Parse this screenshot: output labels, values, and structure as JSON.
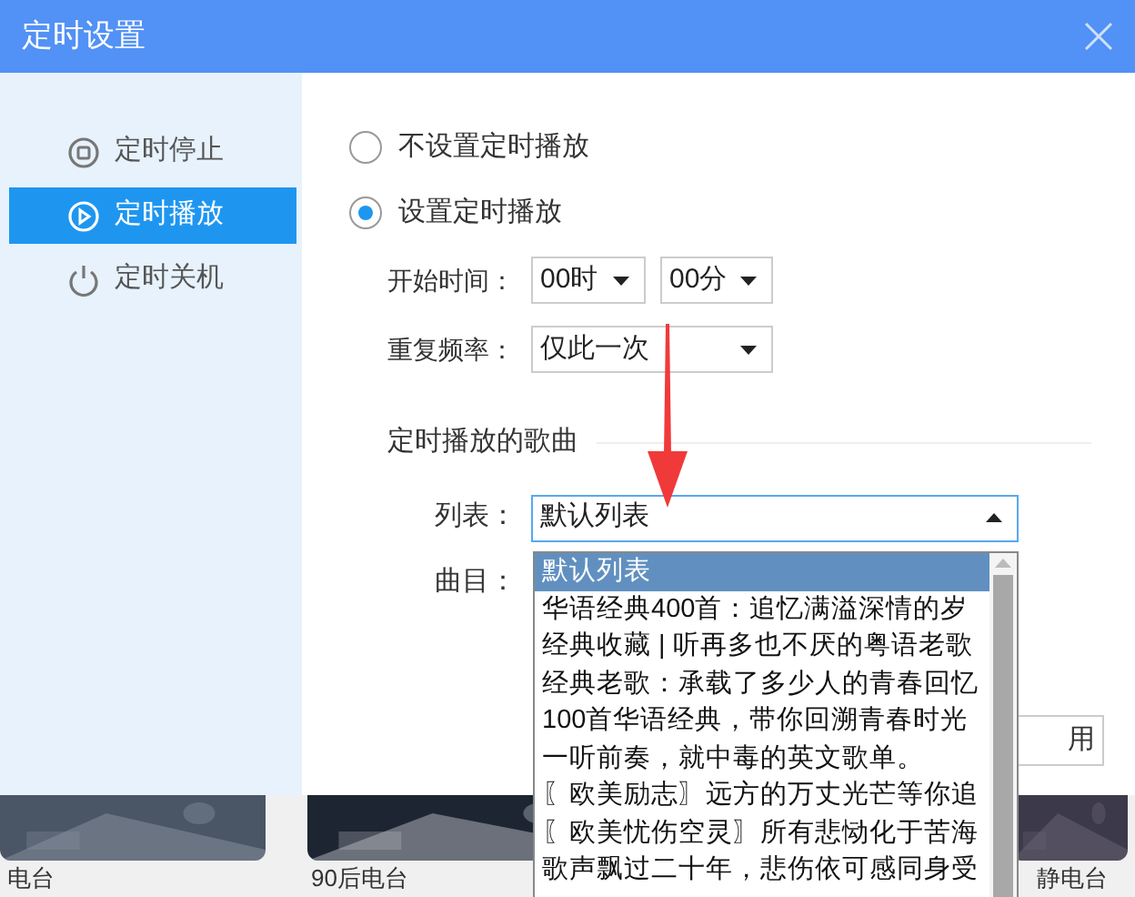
{
  "window": {
    "title": "定时设置"
  },
  "sidebar": {
    "items": [
      {
        "label": "定时停止",
        "kind": "stop",
        "selected": false
      },
      {
        "label": "定时播放",
        "kind": "play",
        "selected": true
      },
      {
        "label": "定时关机",
        "kind": "power",
        "selected": false
      }
    ]
  },
  "radios": [
    {
      "label": "不设置定时播放",
      "selected": false
    },
    {
      "label": "设置定时播放",
      "selected": true
    }
  ],
  "start_time": {
    "label": "开始时间：",
    "hour": "00时",
    "minute": "00分"
  },
  "repeat": {
    "label": "重复频率：",
    "value": "仅此一次"
  },
  "songs": {
    "title": "定时播放的歌曲",
    "list_label": "列表：",
    "list_value": "默认列表",
    "track_label": "曲目："
  },
  "apply_button": "用",
  "dropdown": {
    "options": [
      {
        "label": "默认列表",
        "selected": true
      },
      {
        "label": "华语经典400首：追忆满溢深情的岁",
        "selected": false
      },
      {
        "label": "经典收藏 | 听再多也不厌的粤语老歌",
        "selected": false
      },
      {
        "label": "经典老歌：承载了多少人的青春回忆",
        "selected": false
      },
      {
        "label": "100首华语经典，带你回溯青春时光",
        "selected": false
      },
      {
        "label": "一听前奏，就中毒的英文歌单。",
        "selected": false
      },
      {
        "label": "〖欧美励志〗远方的万丈光芒等你追",
        "selected": false
      },
      {
        "label": "〖欧美忧伤空灵〗所有悲恸化于苦海",
        "selected": false
      },
      {
        "label": "歌声飘过二十年，悲伤依可感同身受",
        "selected": false
      }
    ]
  },
  "background_tiles": [
    {
      "label": "电台"
    },
    {
      "label": "90后电台"
    },
    {
      "label": "静电台"
    }
  ]
}
